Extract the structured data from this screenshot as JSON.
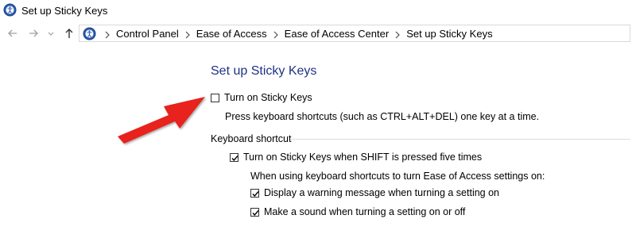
{
  "window": {
    "title": "Set up Sticky Keys"
  },
  "nav": {
    "back": "back-arrow-icon",
    "forward": "forward-arrow-icon",
    "recent": "chevron-down-icon",
    "up": "up-arrow-icon"
  },
  "breadcrumb": [
    "Control Panel",
    "Ease of Access",
    "Ease of Access Center",
    "Set up Sticky Keys"
  ],
  "page": {
    "heading": "Set up Sticky Keys",
    "turn_on": {
      "label": "Turn on Sticky Keys",
      "checked": false
    },
    "turn_on_desc": "Press keyboard shortcuts (such as CTRL+ALT+DEL) one key at a time.",
    "keyboard_shortcut": {
      "label": "Keyboard shortcut",
      "shift_five": {
        "label": "Turn on Sticky Keys when SHIFT is pressed five times",
        "checked": true
      },
      "subtext": "When using keyboard shortcuts to turn Ease of Access settings on:",
      "warning": {
        "label": "Display a warning message when turning a setting on",
        "checked": true
      },
      "sound": {
        "label": "Make a sound when turning a setting on or off",
        "checked": true
      }
    }
  },
  "colors": {
    "heading": "#1e3287",
    "arrow": "#e8231b"
  }
}
